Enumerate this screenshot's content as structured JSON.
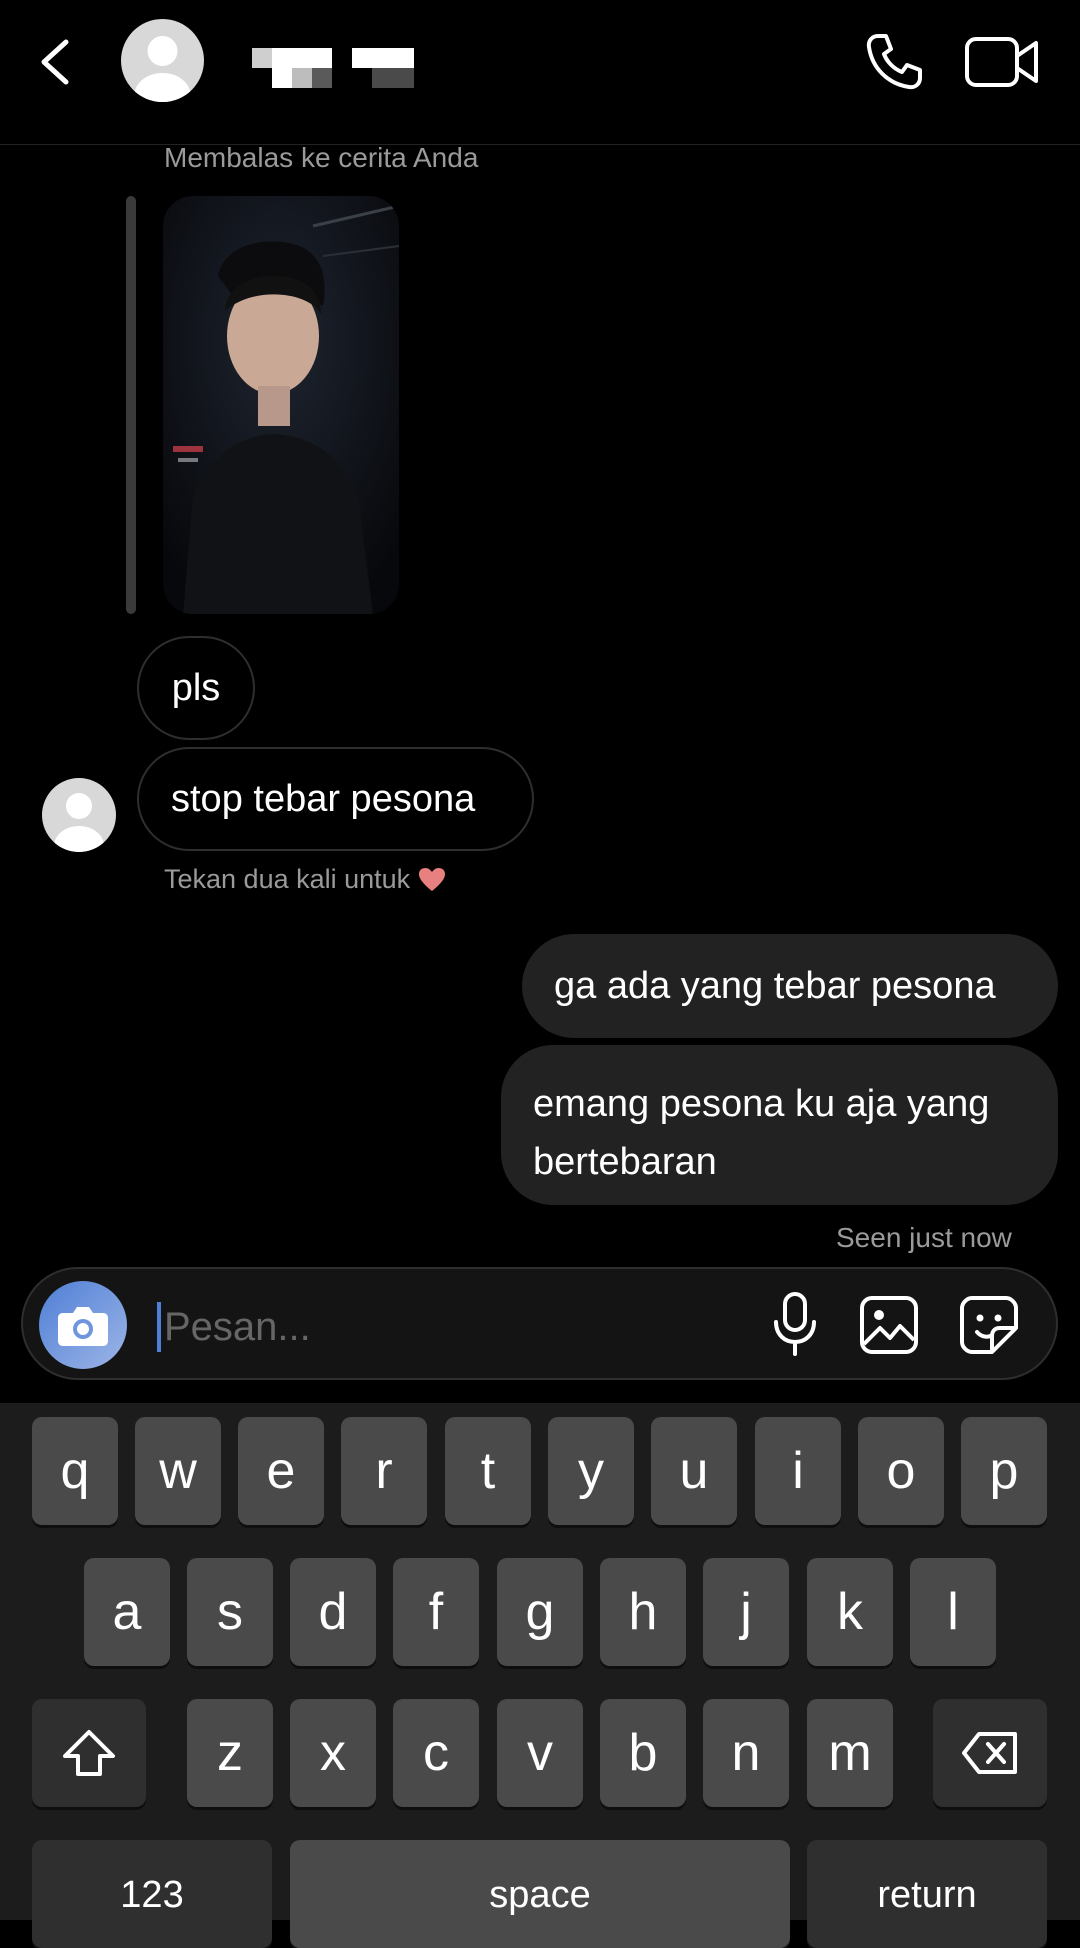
{
  "header": {
    "back_icon": "chevron-left-icon",
    "call_icon": "phone-icon",
    "video_icon": "video-camera-icon"
  },
  "thread": {
    "reply_caption": "Membalas ke cerita Anda",
    "incoming": [
      "pls",
      "stop tebar pesona"
    ],
    "reaction_hint": "Tekan dua kali untuk",
    "hint_icon": "heart-icon",
    "outgoing": [
      {
        "lines": [
          "ga ada yang tebar pesona"
        ]
      },
      {
        "lines": [
          "emang pesona ku aja yang",
          "bertebaran"
        ]
      }
    ],
    "seen": "Seen just now"
  },
  "composer": {
    "placeholder": "Pesan...",
    "value": "",
    "icons": [
      "camera-icon",
      "microphone-icon",
      "image-icon",
      "sticker-icon"
    ]
  },
  "keyboard": {
    "row1": [
      "q",
      "w",
      "e",
      "r",
      "t",
      "y",
      "u",
      "i",
      "o",
      "p"
    ],
    "row2": [
      "a",
      "s",
      "d",
      "f",
      "g",
      "h",
      "j",
      "k",
      "l"
    ],
    "row3": [
      "z",
      "x",
      "c",
      "v",
      "b",
      "n",
      "m"
    ],
    "numbers_label": "123",
    "space_label": "space",
    "return_label": "return"
  },
  "colors": {
    "background": "#000000",
    "incoming_border": "#2e2e2e",
    "outgoing_bubble": "#222222",
    "accent": "#4f7fd6",
    "heart": "#e88080"
  }
}
